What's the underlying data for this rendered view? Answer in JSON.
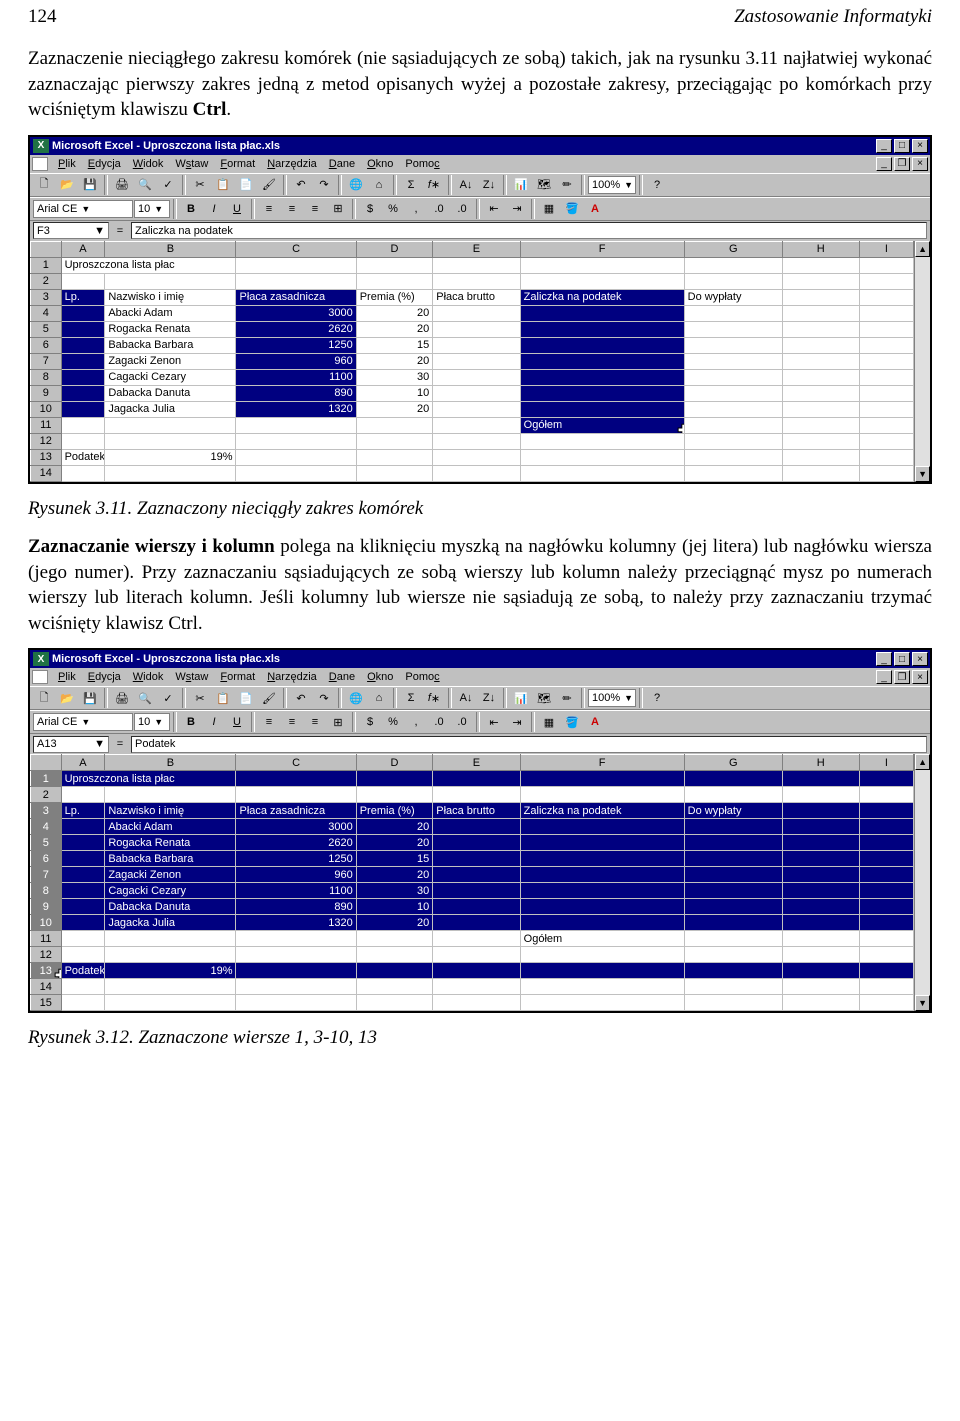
{
  "page": {
    "num": "124",
    "header": "Zastosowanie Informatyki"
  },
  "para1_a": "Zaznaczenie nieciągłego zakresu komórek (nie sąsiadujących ze sobą) takich, jak na rysunku 3.11 najłatwiej wykonać zaznaczając pierwszy zakres jedną z metod opisanych wyżej a pozostałe zakresy, przeciągając po komórkach przy wciśniętym klawiszu ",
  "para1_b": "Ctrl",
  "para1_c": ".",
  "caption1": "Rysunek 3.11. Zaznaczony nieciągły zakres komórek",
  "para2_a": "Zaznaczanie wierszy i kolumn",
  "para2_b": " polega na kliknięciu myszką na nagłówku kolumny (jej litera) lub nagłówku wiersza (jego numer). Przy zaznaczaniu sąsiadujących ze sobą wierszy lub kolumn należy przeciągnąć mysz po numerach wierszy lub literach kolumn. Jeśli kolumny lub wiersze nie sąsiadują ze sobą, to należy przy zaznaczaniu trzymać wciśnięty klawisz Ctrl.",
  "caption2": "Rysunek 3.12. Zaznaczone wiersze 1, 3-10, 13",
  "excel": {
    "title": "Microsoft Excel - Uproszczona lista płac.xls",
    "menus": [
      "Plik",
      "Edycja",
      "Widok",
      "Wstaw",
      "Format",
      "Narzędzia",
      "Dane",
      "Okno",
      "Pomoc"
    ],
    "zoom": "100%",
    "font": "Arial CE",
    "fontSize": "10",
    "colLetters": [
      "A",
      "B",
      "C",
      "D",
      "E",
      "F",
      "G",
      "H",
      "I"
    ],
    "headers": {
      "lp": "Lp.",
      "name": "Nazwisko i imię",
      "base": "Płaca zasadnicza",
      "premia": "Premia (%)",
      "brutto": "Płaca brutto",
      "zaliczka": "Zaliczka na podatek",
      "wyplata": "Do wypłaty"
    },
    "title_cell": "Uproszczona lista płac",
    "ogolem": "Ogółem",
    "podatek_label": "Podatek",
    "podatek_val": "19%",
    "rows": [
      {
        "name": "Abacki Adam",
        "base": "3000",
        "premia": "20"
      },
      {
        "name": "Rogacka Renata",
        "base": "2620",
        "premia": "20"
      },
      {
        "name": "Babacka Barbara",
        "base": "1250",
        "premia": "15"
      },
      {
        "name": "Zagacki Zenon",
        "base": "960",
        "premia": "20"
      },
      {
        "name": "Cagacki Cezary",
        "base": "1100",
        "premia": "30"
      },
      {
        "name": "Dabacka Danuta",
        "base": "890",
        "premia": "10"
      },
      {
        "name": "Jagacka Julia",
        "base": "1320",
        "premia": "20"
      }
    ],
    "fig1": {
      "nameBox": "F3",
      "formula": "Zaliczka na podatek"
    },
    "fig2": {
      "nameBox": "A13",
      "formula": "Podatek"
    }
  }
}
